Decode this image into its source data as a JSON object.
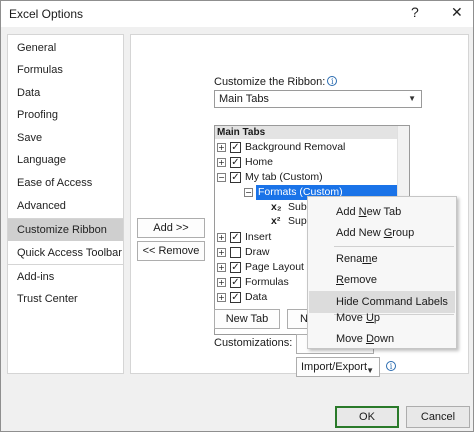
{
  "window": {
    "title": "Excel Options",
    "help_glyph": "?",
    "close_glyph": "✕"
  },
  "sidebar": {
    "items": [
      {
        "label": "General"
      },
      {
        "label": "Formulas"
      },
      {
        "label": "Data"
      },
      {
        "label": "Proofing"
      },
      {
        "label": "Save"
      },
      {
        "label": "Language"
      },
      {
        "label": "Ease of Access"
      },
      {
        "label": "Advanced"
      },
      {
        "label": "Customize Ribbon",
        "selected": true
      },
      {
        "label": "Quick Access Toolbar"
      },
      {
        "label": "Add-ins"
      },
      {
        "label": "Trust Center"
      }
    ]
  },
  "ribbon": {
    "customize_label": "Customize the Ribbon:",
    "dropdown_value": "Main Tabs",
    "tree_header": "Main Tabs",
    "tree": [
      {
        "label": "Background Removal",
        "expander": "+",
        "checked": true
      },
      {
        "label": "Home",
        "expander": "+",
        "checked": true
      },
      {
        "label": "My tab (Custom)",
        "expander": "−",
        "checked": true
      },
      {
        "label": "Formats (Custom)",
        "expander": "−",
        "selected": true
      },
      {
        "label": "Sub",
        "icon": "subscript-icon",
        "glyph": "x₂"
      },
      {
        "label": "Sup",
        "icon": "superscript-icon",
        "glyph": "x²"
      },
      {
        "label": "Insert",
        "expander": "+",
        "checked": true
      },
      {
        "label": "Draw",
        "expander": "+",
        "checked": false
      },
      {
        "label": "Page Layout",
        "expander": "+",
        "checked": true
      },
      {
        "label": "Formulas",
        "expander": "+",
        "checked": true
      },
      {
        "label": "Data",
        "expander": "+",
        "checked": true
      }
    ],
    "add_button": "Add >>",
    "remove_button": "<< Remove",
    "new_tab_button": "New Tab",
    "new_group_button_partial": "Ne",
    "customizations_label": "Customizations:",
    "import_export_label": "Import/Export"
  },
  "context_menu": {
    "items": [
      {
        "label": "Add New Tab"
      },
      {
        "label": "Add New Group"
      },
      {
        "label": "Rename"
      },
      {
        "label": "Remove"
      },
      {
        "label": "Hide Command Labels",
        "highlighted": true
      },
      {
        "label": "Move Up"
      },
      {
        "label": "Move Down"
      }
    ]
  },
  "footer": {
    "ok": "OK",
    "cancel": "Cancel"
  },
  "colors": {
    "selection": "#1a73e8",
    "arrow": "#1a73e8",
    "ok_border": "#2a7a2a"
  }
}
